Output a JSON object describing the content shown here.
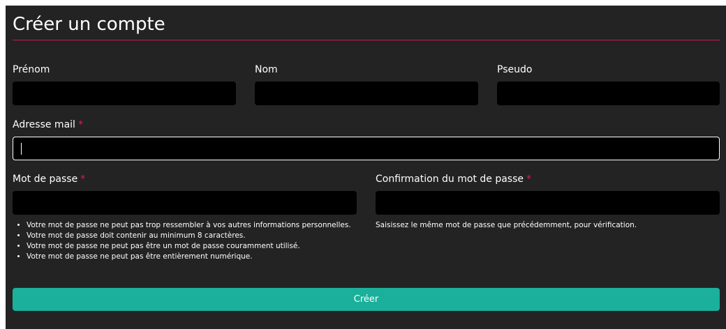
{
  "form": {
    "title": "Créer un compte",
    "fields": {
      "first_name": {
        "label": "Prénom",
        "value": ""
      },
      "last_name": {
        "label": "Nom",
        "value": ""
      },
      "username": {
        "label": "Pseudo",
        "value": ""
      },
      "email": {
        "label": "Adresse mail",
        "required_mark": "*",
        "value": ""
      },
      "password": {
        "label": "Mot de passe",
        "required_mark": "*",
        "value": ""
      },
      "password_confirm": {
        "label": "Confirmation du mot de passe",
        "required_mark": "*",
        "value": ""
      }
    },
    "password_help": [
      "Votre mot de passe ne peut pas trop ressembler à vos autres informations personnelles.",
      "Votre mot de passe doit contenir au minimum 8 caractères.",
      "Votre mot de passe ne peut pas être un mot de passe couramment utilisé.",
      "Votre mot de passe ne peut pas être entièrement numérique."
    ],
    "confirm_help": "Saisissez le même mot de passe que précédemment, pour vérification.",
    "submit_label": "Créer"
  },
  "colors": {
    "background": "#232323",
    "accent_rule": "#c8185c",
    "required": "#d11f59",
    "submit": "#1ab09b"
  }
}
